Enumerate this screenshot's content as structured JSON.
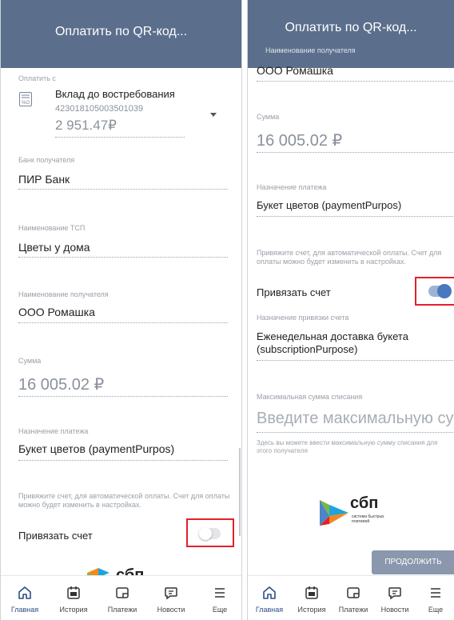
{
  "screen1": {
    "title": "Оплатить по QR-код...",
    "pay_from_label": "Оплатить с",
    "account_name": "Вклад до востребования",
    "account_number": "423018105003501039",
    "account_balance": "2 951.47₽",
    "bank_label": "Банк получателя",
    "bank_value": "ПИР Банк",
    "tsp_label": "Наименование ТСП",
    "tsp_value": "Цветы  у дома",
    "recipient_label": "Наименование получателя",
    "recipient_value": "ООО Ромашка",
    "sum_label": "Сумма",
    "sum_value": "16 005.02 ₽",
    "purpose_label": "Назначение платежа",
    "purpose_value": "Букет цветов (paymentPurpos)",
    "bind_hint": "Привяжите счет, для автоматической оплаты. Счет для оплаты можно будет изменить в настройках.",
    "bind_label": "Привязать счет",
    "bind_enabled": false,
    "sbp_text": "сбп"
  },
  "screen2": {
    "title": "Оплатить по QR-код...",
    "recipient_label": "Наименование получателя",
    "recipient_value": "ООО Ромашка",
    "sum_label": "Сумма",
    "sum_value": "16 005.02 ₽",
    "purpose_label": "Назначение платежа",
    "purpose_value": "Букет цветов (paymentPurpos)",
    "bind_hint": "Привяжите счет, для автоматической оплаты. Счет для оплаты можно будет изменить в настройках.",
    "bind_label": "Привязать счет",
    "bind_enabled": true,
    "binding_purpose_label": "Назначение привязки счета",
    "binding_purpose_value_line1": "Еженедельная доставка букета",
    "binding_purpose_value_line2": "(subscriptionPurpose)",
    "max_sum_label": "Максимальная сумма списания",
    "max_sum_placeholder": "Введите максимальную сум",
    "max_sum_hint": "Здесь вы можете ввести максимальную сумму списания для этого получателя",
    "sbp_text": "сбп",
    "sbp_subtitle_line1": "система быстрых",
    "sbp_subtitle_line2": "платежей",
    "continue_button": "ПРОДОЛЖИТЬ"
  },
  "tabbar": {
    "tabs": [
      {
        "label": "Главная",
        "icon": "home-icon",
        "active": true
      },
      {
        "label": "История",
        "icon": "history-icon",
        "active": false
      },
      {
        "label": "Платежи",
        "icon": "payments-icon",
        "active": false
      },
      {
        "label": "Новости",
        "icon": "news-icon",
        "active": false
      },
      {
        "label": "Еще",
        "icon": "menu-icon",
        "active": false
      }
    ]
  },
  "colors": {
    "header": "#5b6f8c",
    "accent": "#2d4f87",
    "highlight_frame": "#e3202a",
    "toggle_on": "#4a78bf"
  }
}
